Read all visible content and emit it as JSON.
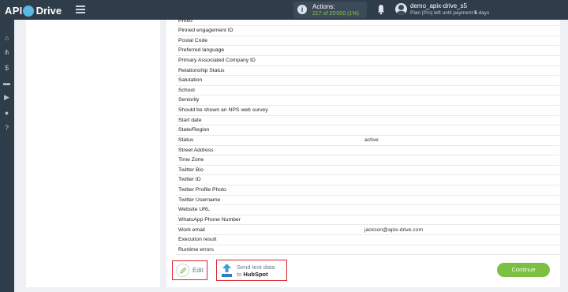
{
  "brand": {
    "name_part1": "API",
    "name_part2": "Drive"
  },
  "actions": {
    "label": "Actions:",
    "count": "217 of 25'000 (1%)"
  },
  "user": {
    "name": "demo_apix-drive_s5",
    "plan_prefix": "Plan |Pro| left until payment",
    "plan_days": "5",
    "plan_suffix": "days"
  },
  "sidebar": {
    "items": [
      {
        "icon": "home-icon",
        "glyph": "⌂"
      },
      {
        "icon": "sitemap-icon",
        "glyph": "⋔"
      },
      {
        "icon": "dollar-icon",
        "glyph": "$"
      },
      {
        "icon": "briefcase-icon",
        "glyph": "▬"
      },
      {
        "icon": "video-icon",
        "glyph": "▶"
      },
      {
        "icon": "user-icon",
        "glyph": "●"
      },
      {
        "icon": "help-icon",
        "glyph": "?"
      }
    ]
  },
  "fields": [
    {
      "name": "Photo",
      "value": ""
    },
    {
      "name": "Pinned engagement ID",
      "value": ""
    },
    {
      "name": "Postal Code",
      "value": ""
    },
    {
      "name": "Preferred language",
      "value": ""
    },
    {
      "name": "Primary Associated Company ID",
      "value": ""
    },
    {
      "name": "Relationship Status",
      "value": ""
    },
    {
      "name": "Salutation",
      "value": ""
    },
    {
      "name": "School",
      "value": ""
    },
    {
      "name": "Seniority",
      "value": ""
    },
    {
      "name": "Should be shown an NPS web survey",
      "value": ""
    },
    {
      "name": "Start date",
      "value": ""
    },
    {
      "name": "State/Region",
      "value": ""
    },
    {
      "name": "Status",
      "value": "active"
    },
    {
      "name": "Street Address",
      "value": ""
    },
    {
      "name": "Time Zone",
      "value": ""
    },
    {
      "name": "Twitter Bio",
      "value": ""
    },
    {
      "name": "Twitter ID",
      "value": ""
    },
    {
      "name": "Twitter Profile Photo",
      "value": ""
    },
    {
      "name": "Twitter Username",
      "value": ""
    },
    {
      "name": "Website URL",
      "value": ""
    },
    {
      "name": "WhatsApp Phone Number",
      "value": ""
    },
    {
      "name": "Work email",
      "value": "jackson@apix-drive.com"
    },
    {
      "name": "Execution result",
      "value": ""
    },
    {
      "name": "Runtime errors",
      "value": ""
    }
  ],
  "buttons": {
    "edit_label": "Edit",
    "send_line1": "Send test data",
    "send_line2_prefix": "to",
    "send_line2_target": "HubSpot",
    "continue_label": "Continue"
  },
  "colors": {
    "topbar": "#2f3c4a",
    "accent_green": "#7cbf42",
    "highlight_red": "#d9262e"
  }
}
